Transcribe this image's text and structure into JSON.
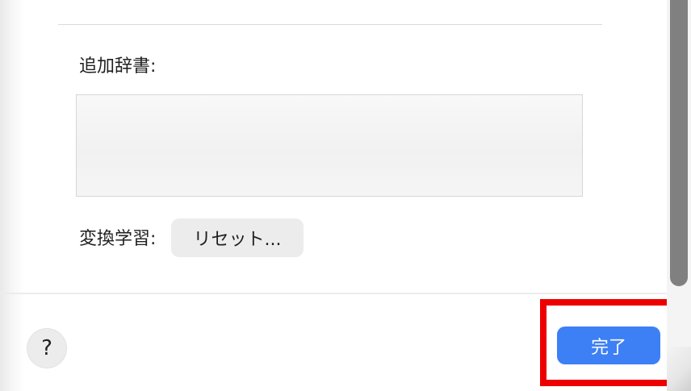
{
  "dictionary": {
    "label": "追加辞書:"
  },
  "learning": {
    "label": "変換学習:",
    "reset_label": "リセット..."
  },
  "footer": {
    "help_label": "?",
    "done_label": "完了"
  },
  "colors": {
    "accent": "#3d7ff5",
    "highlight": "#ee0000",
    "scroll_thumb": "#808080"
  }
}
